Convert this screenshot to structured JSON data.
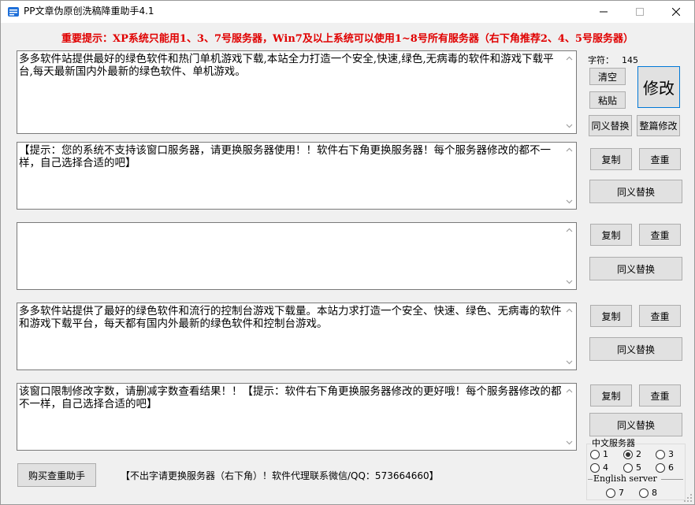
{
  "window": {
    "title": "PP文章伪原创洗稿降重助手4.1"
  },
  "warning": "重要提示：XP系统只能用1、3、7号服务器，Win7及以上系统可以使用1~8号所有服务器（右下角推荐2、4、5号服务器）",
  "editor": {
    "input_text": "多多软件站提供最好的绿色软件和热门单机游戏下载,本站全力打造一个安全,快速,绿色,无病毒的软件和游戏下载平台,每天最新国内外最新的绿色软件、单机游戏。",
    "char_count_label": "字符：",
    "char_count": "145",
    "clear_label": "清空",
    "paste_label": "粘贴",
    "modify_label": "修改",
    "synonym_label": "同义替换",
    "full_modify_label": "整篇修改"
  },
  "outputs": [
    {
      "text": "【提示：您的系统不支持该窗口服务器，请更换服务器使用！！软件右下角更换服务器！每个服务器修改的都不一样，自己选择合适的吧】",
      "copy_label": "复制",
      "check_label": "查重",
      "synonym_label": "同义替换"
    },
    {
      "text": "",
      "copy_label": "复制",
      "check_label": "查重",
      "synonym_label": "同义替换"
    },
    {
      "text": "多多软件站提供了最好的绿色软件和流行的控制台游戏下载量。本站力求打造一个安全、快速、绿色、无病毒的软件和游戏下载平台，每天都有国内外最新的绿色软件和控制台游戏。",
      "copy_label": "复制",
      "check_label": "查重",
      "synonym_label": "同义替换"
    },
    {
      "text": "该窗口限制修改字数，请删减字数查看结果！！【提示：软件右下角更换服务器修改的更好哦！每个服务器修改的都不一样，自己选择合适的吧】",
      "copy_label": "复制",
      "check_label": "查重",
      "synonym_label": "同义替换"
    }
  ],
  "servers": {
    "chinese_title": "中文服务器",
    "english_title": "English server",
    "options": [
      "1",
      "2",
      "3",
      "4",
      "5",
      "6",
      "7",
      "8"
    ],
    "selected": "2"
  },
  "footer": {
    "buy_button_label": "购买查重助手",
    "note": "【不出字请更换服务器（右下角）！软件代理联系微信/QQ：573664660】"
  },
  "colors": {
    "warning": "#e00000",
    "focus_border": "#0078d7",
    "window_bg": "#f0f0f0"
  }
}
